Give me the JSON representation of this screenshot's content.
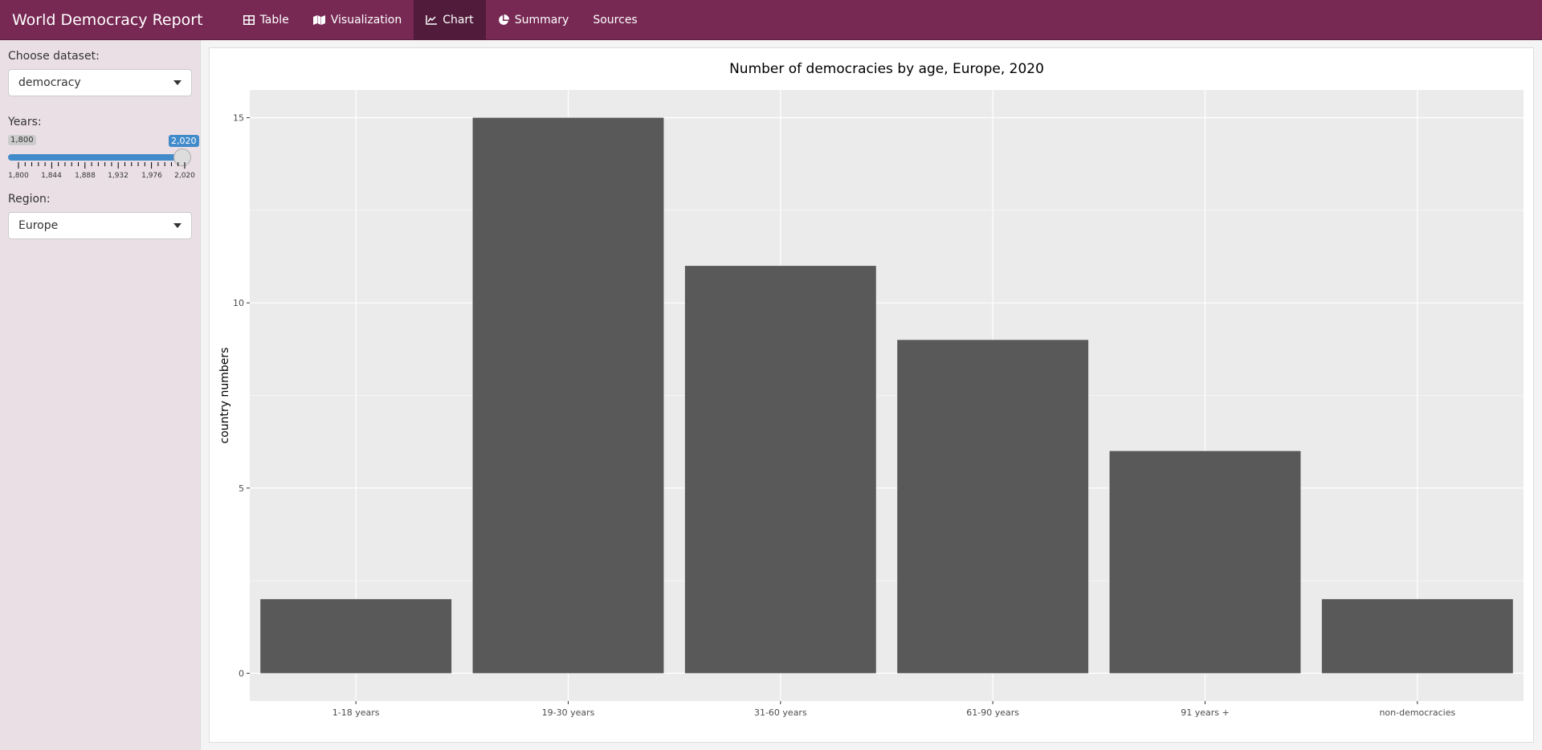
{
  "navbar": {
    "brand": "World Democracy Report",
    "tabs": [
      {
        "label": "Table",
        "icon": "table-icon"
      },
      {
        "label": "Visualization",
        "icon": "map-icon"
      },
      {
        "label": "Chart",
        "icon": "line-chart-icon",
        "active": true
      },
      {
        "label": "Summary",
        "icon": "pie-chart-icon"
      },
      {
        "label": "Sources"
      }
    ]
  },
  "sidebar": {
    "dataset_label": "Choose dataset:",
    "dataset_value": "democracy",
    "years_label": "Years:",
    "years_min": "1,800",
    "years_max": "2,020",
    "year_ticks": [
      "1,800",
      "1,844",
      "1,888",
      "1,932",
      "1,976",
      "2,020"
    ],
    "region_label": "Region:",
    "region_value": "Europe"
  },
  "chart_data": {
    "type": "bar",
    "title": "Number of democracies by age, Europe, 2020",
    "xlabel": "",
    "ylabel": "country numbers",
    "categories": [
      "1-18 years",
      "19-30 years",
      "31-60 years",
      "61-90 years",
      "91 years +",
      "non-democracies"
    ],
    "values": [
      2,
      15,
      11,
      9,
      6,
      2
    ],
    "yticks": [
      0,
      5,
      10,
      15
    ],
    "ylim": [
      -0.75,
      15.75
    ],
    "grid": true,
    "bar_color": "#595959"
  }
}
